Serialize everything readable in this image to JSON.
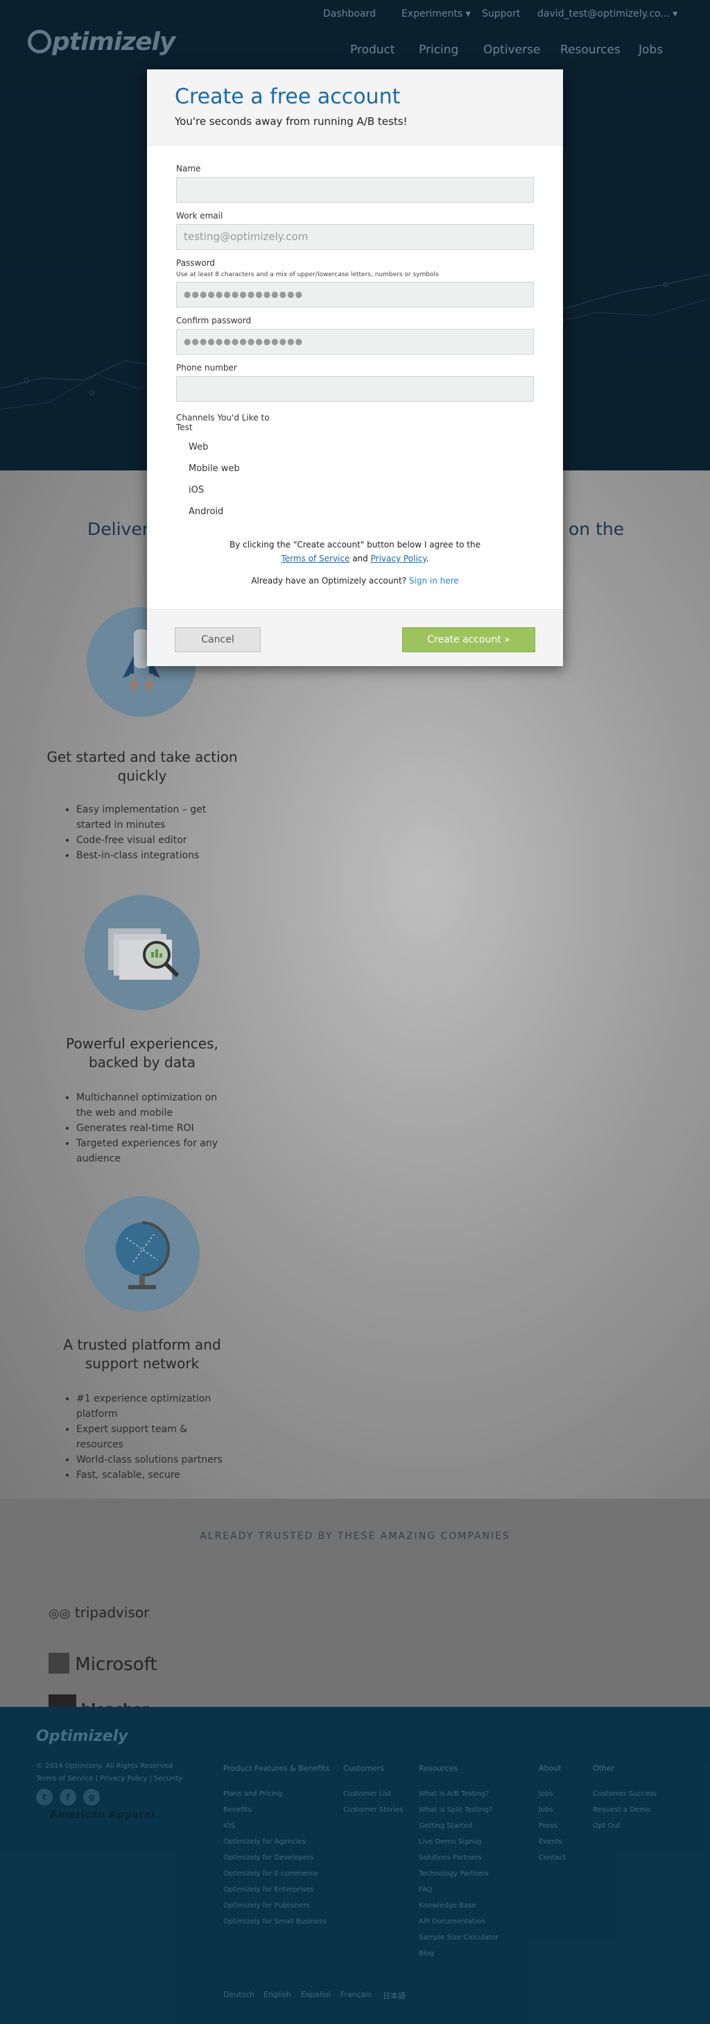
{
  "topnav": {
    "dashboard": "Dashboard",
    "experiments": "Experiments ▾",
    "support": "Support",
    "account": "david_test@optimizely.co... ▾"
  },
  "logo": "ptimizely",
  "mainnav": [
    "Product",
    "Pricing",
    "Optiverse",
    "Resources",
    "Jobs"
  ],
  "content": {
    "headline_left": "Deliver",
    "headline_right": "on the",
    "features": [
      {
        "title": "Get started and take action quickly",
        "icon": "rocket-icon",
        "items": [
          "Easy implementation – get started in minutes",
          "Code-free visual editor",
          "Best-in-class integrations"
        ]
      },
      {
        "title": "Powerful experiences, backed by data",
        "icon": "magnifier-screen-icon",
        "items": [
          "Multichannel optimization on the web and mobile",
          "Generates real-time ROI",
          "Targeted experiences for any audience"
        ]
      },
      {
        "title": "A trusted platform and support network",
        "icon": "globe-icon",
        "items": [
          "#1 experience optimization platform",
          "Expert support team & resources",
          "World-class solutions partners",
          "Fast, scalable, secure"
        ]
      }
    ]
  },
  "trusted": {
    "caption": "ALREADY TRUSTED BY THESE AMAZING COMPANIES",
    "brands": [
      "tripadvisor",
      "Microsoft",
      "bleacher report",
      "American Apparel"
    ]
  },
  "footer": {
    "logo": "Optimizely",
    "copyright": "© 2014 Optimizely. All Rights Reserved",
    "legal": [
      "Terms of Service",
      "Privacy Policy",
      "Security"
    ],
    "columns": [
      {
        "heading": "Product Features & Benefits",
        "links": [
          "Plans and Pricing",
          "Benefits",
          "iOS",
          "Optimizely for Agencies",
          "Optimizely for Developers",
          "Optimizely for E-commerce",
          "Optimizely for Enterprises",
          "Optimizely for Publishers",
          "Optimizely for Small Business"
        ]
      },
      {
        "heading": "Customers",
        "links": [
          "Customer List",
          "Customer Stories"
        ]
      },
      {
        "heading": "Resources",
        "links": [
          "What is A/B Testing?",
          "What is Split Testing?",
          "Getting Started",
          "Live Demo Signup",
          "Solutions Partners",
          "Technology Partners",
          "FAQ",
          "Knowledge Base",
          "API Documentation",
          "Sample Size Calculator",
          "Blog"
        ]
      },
      {
        "heading": "About",
        "links": [
          "Jobs",
          "Jobs",
          "Press",
          "Events",
          "Contact"
        ]
      },
      {
        "heading": "Other",
        "links": [
          "Customer Success",
          "Request a Demo",
          "Opt Out"
        ]
      }
    ],
    "languages": [
      "Deutsch",
      "English",
      "Español",
      "Français",
      "日本語"
    ]
  },
  "modal": {
    "title": "Create a free account",
    "subtitle": "You're seconds away from running A/B tests!",
    "name_label": "Name",
    "email_label": "Work email",
    "email_value": "testing@optimizely.com",
    "password_label": "Password",
    "password_hint": "Use at least 8 characters and a mix of upper/lowercase letters, numbers or symbols",
    "password_value": "●●●●●●●●●●●●●●●",
    "confirm_label": "Confirm password",
    "confirm_value": "●●●●●●●●●●●●●●●",
    "phone_label": "Phone number",
    "channels_label_1": "Channels You'd Like to",
    "channels_label_2": "Test",
    "channels": [
      "Web",
      "Mobile web",
      "iOS",
      "Android"
    ],
    "terms_prefix": "By clicking the \"Create account\" button below I agree to the",
    "terms_link": "Terms of Service",
    "terms_and": "and",
    "privacy_link": "Privacy Policy",
    "terms_end": ".",
    "signin_text": "Already have an Optimizely account?",
    "signin_link": "Sign in here",
    "cancel": "Cancel",
    "create": "Create account »"
  },
  "colors": {
    "header_bg": "#0c2534",
    "accent_blue": "#1a6aa8",
    "create_green": "#9dc35e",
    "footer_bg": "#0b3b54"
  }
}
